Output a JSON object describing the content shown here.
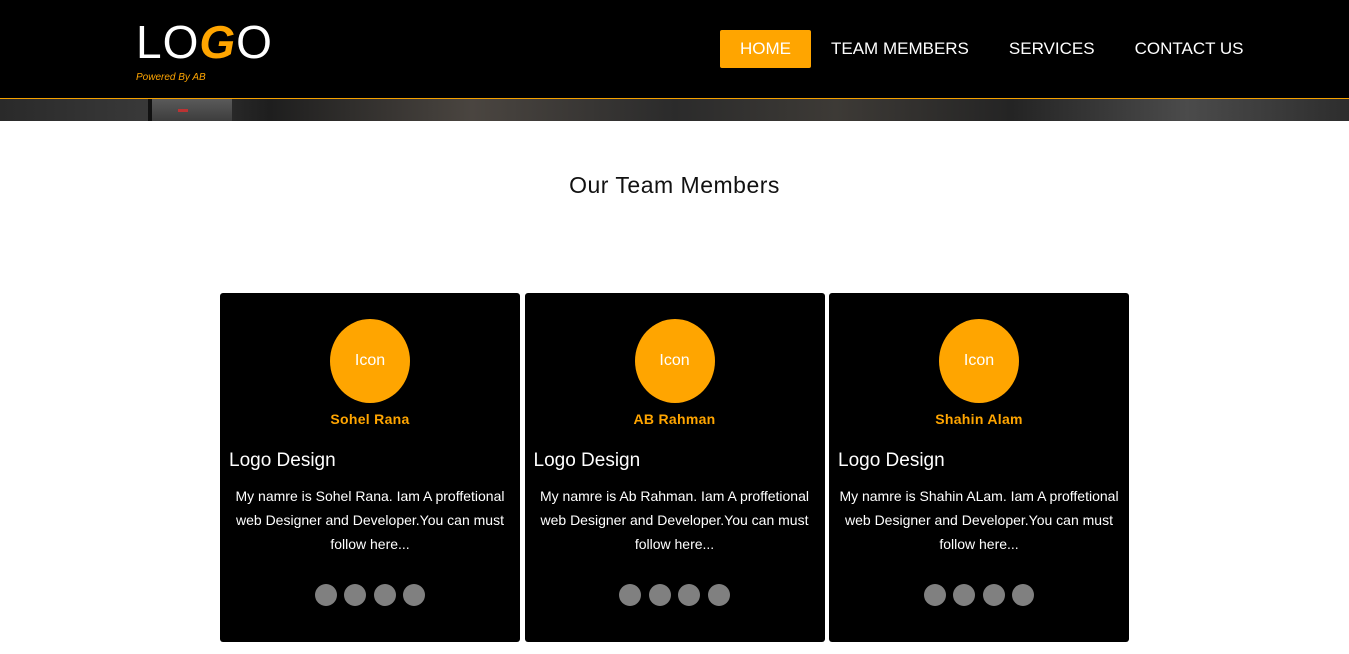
{
  "brand": {
    "logo_part1": "LO",
    "logo_accent": "G",
    "logo_part2": "O",
    "tagline": "Powered By AB"
  },
  "nav": {
    "home": "HOME",
    "team": "TEAM MEMBERS",
    "services": "SERVICES",
    "contact": "CONTACT US",
    "active": "HOME"
  },
  "section": {
    "title": "Our Team Members"
  },
  "members": [
    {
      "icon_label": "Icon",
      "name": "Sohel Rana",
      "role": "Logo Design",
      "bio": "My namre is Sohel Rana. Iam A proffetional web Designer and Developer.You can must follow here..."
    },
    {
      "icon_label": "Icon",
      "name": "AB Rahman",
      "role": "Logo Design",
      "bio": "My namre is Ab Rahman. Iam A proffetional web Designer and Developer.You can must follow here..."
    },
    {
      "icon_label": "Icon",
      "name": "Shahin Alam",
      "role": "Logo Design",
      "bio": "My namre is Shahin ALam. Iam A proffetional web Designer and Developer.You can must follow here..."
    }
  ],
  "colors": {
    "accent": "#ffa500",
    "header_bg": "#000000",
    "card_bg": "#000000",
    "social_dot": "#808080"
  }
}
